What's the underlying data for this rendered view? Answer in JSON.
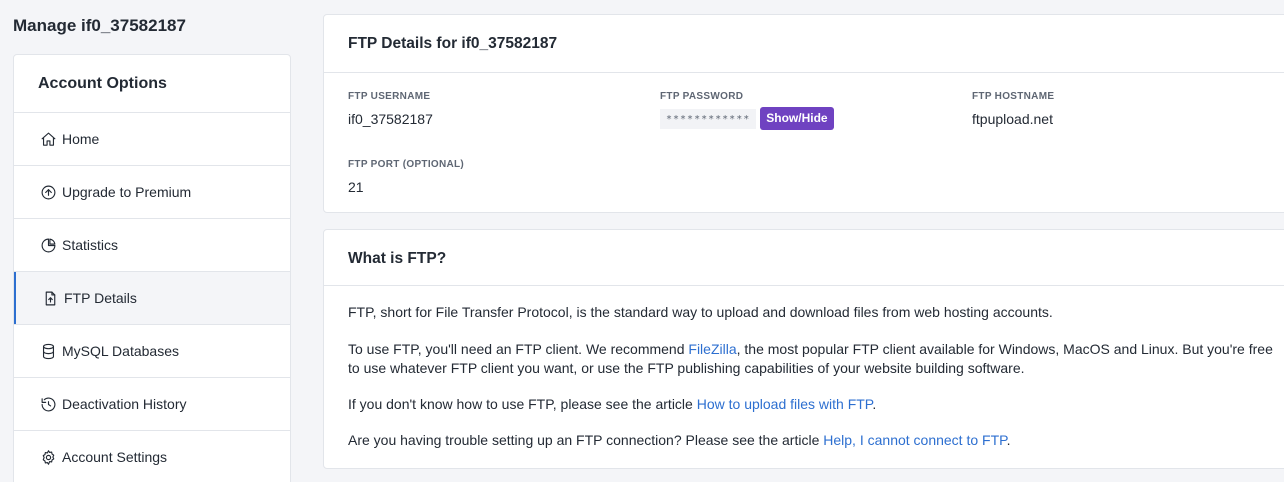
{
  "page": {
    "title": "Manage if0_37582187"
  },
  "sidebar": {
    "title": "Account Options",
    "items": [
      {
        "label": "Home",
        "icon": "home-icon"
      },
      {
        "label": "Upgrade to Premium",
        "icon": "arrow-up-circle-icon"
      },
      {
        "label": "Statistics",
        "icon": "pie-chart-icon"
      },
      {
        "label": "FTP Details",
        "icon": "file-upload-icon",
        "active": true
      },
      {
        "label": "MySQL Databases",
        "icon": "database-icon"
      },
      {
        "label": "Deactivation History",
        "icon": "history-icon"
      },
      {
        "label": "Account Settings",
        "icon": "gear-icon"
      }
    ]
  },
  "ftp": {
    "title": "FTP Details for if0_37582187",
    "username_label": "FTP USERNAME",
    "username": "if0_37582187",
    "password_label": "FTP PASSWORD",
    "password_mask": "************",
    "show_hide_label": "Show/Hide",
    "hostname_label": "FTP HOSTNAME",
    "hostname": "ftpupload.net",
    "port_label": "FTP PORT (OPTIONAL)",
    "port": "21"
  },
  "what": {
    "title": "What is FTP?",
    "p1": "FTP, short for File Transfer Protocol, is the standard way to upload and download files from web hosting accounts.",
    "p2_before": "To use FTP, you'll need an FTP client. We recommend ",
    "p2_link": "FileZilla",
    "p2_after": ", the most popular FTP client available for Windows, MacOS and Linux. But you're free to use whatever FTP client you want, or use the FTP publishing capabilities of your website building software.",
    "p3_before": "If you don't know how to use FTP, please see the article ",
    "p3_link": "How to upload files with FTP",
    "p3_after": ".",
    "p4_before": "Are you having trouble setting up an FTP connection? Please see the article ",
    "p4_link": "Help, I cannot connect to FTP",
    "p4_after": "."
  },
  "colors": {
    "accent": "#2d6fd0",
    "button": "#6f42c1"
  }
}
